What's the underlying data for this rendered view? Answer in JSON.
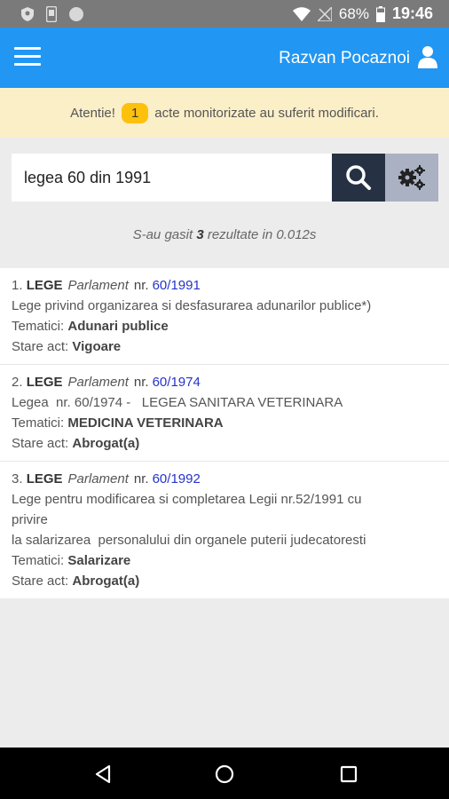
{
  "status_bar": {
    "battery": "68%",
    "time": "19:46"
  },
  "app_bar": {
    "username": "Razvan Pocaznoi"
  },
  "alert": {
    "prefix": "Atentie!",
    "count": "1",
    "suffix": "acte monitorizate au suferit modificari."
  },
  "search": {
    "value": "legea 60 din 1991"
  },
  "result_info": {
    "before": "S-au gasit ",
    "count": "3",
    "after": " rezultate in 0.012s"
  },
  "results": [
    {
      "index": "1.",
      "type": "LEGE",
      "issuer": "Parlament",
      "nr_label": "nr.",
      "nr": "60/1991",
      "title_lines": [
        "Lege privind organizarea si desfasurarea adunarilor publice*)"
      ],
      "tematici_label": "Tematici:",
      "tematici": "Adunari publice",
      "stare_label": "Stare act:",
      "stare": "Vigoare"
    },
    {
      "index": "2.",
      "type": "LEGE",
      "issuer": "Parlament",
      "nr_label": "nr.",
      "nr": "60/1974",
      "title_lines": [
        "Legea  nr. 60/1974 -   LEGEA SANITARA VETERINARA"
      ],
      "tematici_label": "Tematici:",
      "tematici": "MEDICINA VETERINARA",
      "stare_label": "Stare act:",
      "stare": "Abrogat(a)"
    },
    {
      "index": "3.",
      "type": "LEGE",
      "issuer": "Parlament",
      "nr_label": "nr.",
      "nr": "60/1992",
      "title_lines": [
        "Lege pentru modificarea si completarea Legii nr.52/1991 cu",
        "privire",
        "la salarizarea  personalului din organele puterii judecatoresti"
      ],
      "tematici_label": "Tematici:",
      "tematici": "Salarizare",
      "stare_label": "Stare act:",
      "stare": "Abrogat(a)"
    }
  ],
  "colors": {
    "primary": "#2196f3",
    "alert_bg": "#fbefc8",
    "badge": "#fdc10b",
    "search_btn": "#263244",
    "settings_btn": "#a9b1c3",
    "link": "#2433c9"
  }
}
